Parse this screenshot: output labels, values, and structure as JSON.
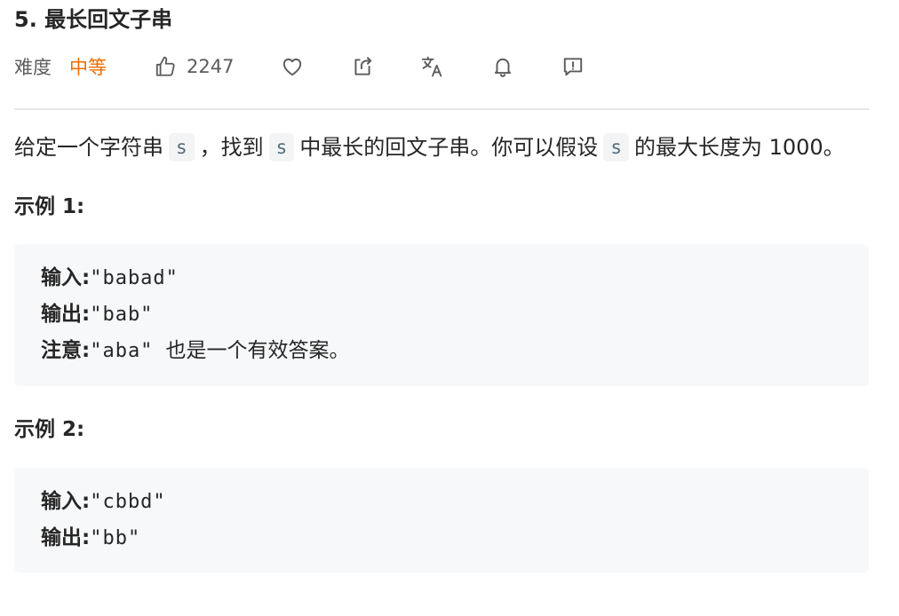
{
  "problem": {
    "title": "5. 最长回文子串",
    "difficulty_label": "难度",
    "difficulty_value": "中等",
    "likes": "2247",
    "icons": [
      "thumbs-up-icon",
      "heart-icon",
      "share-icon",
      "translate-icon",
      "bell-icon",
      "feedback-icon"
    ],
    "accent_color": "#ef6c00"
  },
  "description": {
    "part1": "给定一个字符串",
    "code1": "s",
    "part2": "，找到",
    "code2": "s",
    "part3": "中最长的回文子串。你可以假设",
    "code3": "s",
    "part4": "的最大长度为 1000。"
  },
  "examples": [
    {
      "title": "示例 1:",
      "rows": [
        {
          "key": "输入:",
          "value": "\"babad\"",
          "note": ""
        },
        {
          "key": "输出:",
          "value": "\"bab\"",
          "note": ""
        },
        {
          "key": "注意:",
          "value": "\"aba\"",
          "note": "也是一个有效答案。"
        }
      ]
    },
    {
      "title": "示例 2:",
      "rows": [
        {
          "key": "输入:",
          "value": "\"cbbd\""
        },
        {
          "key": "输出:",
          "value": "\"bb\""
        }
      ]
    }
  ]
}
